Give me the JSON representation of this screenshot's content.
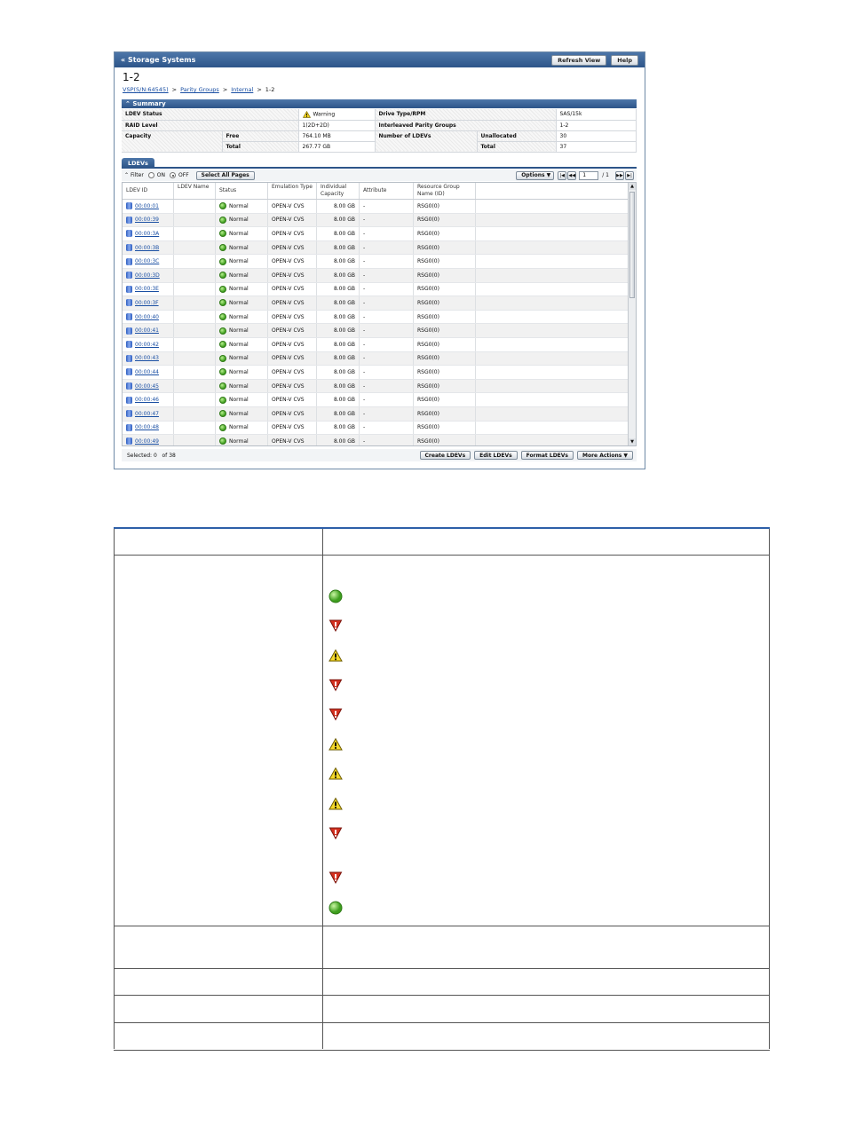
{
  "window": {
    "title": "Storage Systems",
    "refresh_label": "Refresh View",
    "help_label": "Help"
  },
  "page_title": "1-2",
  "breadcrumb": {
    "items": [
      "VSP(S/N:64545)",
      "Parity Groups",
      "Internal"
    ],
    "current": "1-2",
    "separator": ">"
  },
  "summary": {
    "header": "Summary",
    "ldev_status_label": "LDEV Status",
    "ldev_status_value": "Warning",
    "raid_level_label": "RAID Level",
    "raid_level_value": "1(2D+2D)",
    "capacity_label": "Capacity",
    "free_label": "Free",
    "free_value": "764.10 MB",
    "total_label": "Total",
    "total_value": "267.77 GB",
    "drive_type_label": "Drive Type/RPM",
    "drive_type_value": "SAS/15k",
    "interleaved_label": "Interleaved Parity Groups",
    "interleaved_value": "1-2",
    "num_ldevs_label": "Number of LDEVs",
    "unallocated_label": "Unallocated",
    "unallocated_value": "30",
    "ldev_total_label": "Total",
    "ldev_total_value": "37"
  },
  "tab": {
    "label": "LDEVs"
  },
  "toolbar": {
    "filter_label": "Filter",
    "on_label": "ON",
    "off_label": "OFF",
    "select_all_label": "Select All Pages",
    "options_label": "Options",
    "page_value": "1",
    "page_total": "/ 1"
  },
  "columns": [
    "LDEV ID",
    "LDEV Name",
    "Status",
    "Emulation Type",
    "Individual Capacity",
    "Attribute",
    "Resource Group Name (ID)"
  ],
  "rows": [
    {
      "id": "00:00:01",
      "name": "",
      "status": "Normal",
      "emulation": "OPEN-V CVS",
      "capacity": "8.00 GB",
      "attribute": "-",
      "rg": "RSG0(0)"
    },
    {
      "id": "00:00:39",
      "name": "",
      "status": "Normal",
      "emulation": "OPEN-V CVS",
      "capacity": "8.00 GB",
      "attribute": "-",
      "rg": "RSG0(0)"
    },
    {
      "id": "00:00:3A",
      "name": "",
      "status": "Normal",
      "emulation": "OPEN-V CVS",
      "capacity": "8.00 GB",
      "attribute": "-",
      "rg": "RSG0(0)"
    },
    {
      "id": "00:00:3B",
      "name": "",
      "status": "Normal",
      "emulation": "OPEN-V CVS",
      "capacity": "8.00 GB",
      "attribute": "-",
      "rg": "RSG0(0)"
    },
    {
      "id": "00:00:3C",
      "name": "",
      "status": "Normal",
      "emulation": "OPEN-V CVS",
      "capacity": "8.00 GB",
      "attribute": "-",
      "rg": "RSG0(0)"
    },
    {
      "id": "00:00:3D",
      "name": "",
      "status": "Normal",
      "emulation": "OPEN-V CVS",
      "capacity": "8.00 GB",
      "attribute": "-",
      "rg": "RSG0(0)"
    },
    {
      "id": "00:00:3E",
      "name": "",
      "status": "Normal",
      "emulation": "OPEN-V CVS",
      "capacity": "8.00 GB",
      "attribute": "-",
      "rg": "RSG0(0)"
    },
    {
      "id": "00:00:3F",
      "name": "",
      "status": "Normal",
      "emulation": "OPEN-V CVS",
      "capacity": "8.00 GB",
      "attribute": "-",
      "rg": "RSG0(0)"
    },
    {
      "id": "00:00:40",
      "name": "",
      "status": "Normal",
      "emulation": "OPEN-V CVS",
      "capacity": "8.00 GB",
      "attribute": "-",
      "rg": "RSG0(0)"
    },
    {
      "id": "00:00:41",
      "name": "",
      "status": "Normal",
      "emulation": "OPEN-V CVS",
      "capacity": "8.00 GB",
      "attribute": "-",
      "rg": "RSG0(0)"
    },
    {
      "id": "00:00:42",
      "name": "",
      "status": "Normal",
      "emulation": "OPEN-V CVS",
      "capacity": "8.00 GB",
      "attribute": "-",
      "rg": "RSG0(0)"
    },
    {
      "id": "00:00:43",
      "name": "",
      "status": "Normal",
      "emulation": "OPEN-V CVS",
      "capacity": "8.00 GB",
      "attribute": "-",
      "rg": "RSG0(0)"
    },
    {
      "id": "00:00:44",
      "name": "",
      "status": "Normal",
      "emulation": "OPEN-V CVS",
      "capacity": "8.00 GB",
      "attribute": "-",
      "rg": "RSG0(0)"
    },
    {
      "id": "00:00:45",
      "name": "",
      "status": "Normal",
      "emulation": "OPEN-V CVS",
      "capacity": "8.00 GB",
      "attribute": "-",
      "rg": "RSG0(0)"
    },
    {
      "id": "00:00:46",
      "name": "",
      "status": "Normal",
      "emulation": "OPEN-V CVS",
      "capacity": "8.00 GB",
      "attribute": "-",
      "rg": "RSG0(0)"
    },
    {
      "id": "00:00:47",
      "name": "",
      "status": "Normal",
      "emulation": "OPEN-V CVS",
      "capacity": "8.00 GB",
      "attribute": "-",
      "rg": "RSG0(0)"
    },
    {
      "id": "00:00:48",
      "name": "",
      "status": "Normal",
      "emulation": "OPEN-V CVS",
      "capacity": "8.00 GB",
      "attribute": "-",
      "rg": "RSG0(0)"
    },
    {
      "id": "00:00:49",
      "name": "",
      "status": "Normal",
      "emulation": "OPEN-V CVS",
      "capacity": "8.00 GB",
      "attribute": "-",
      "rg": "RSG0(0)"
    }
  ],
  "footer": {
    "selected_label": "Selected:",
    "selected_count": "0",
    "of_label": "of",
    "total_count": "38",
    "create_label": "Create LDEVs",
    "edit_label": "Edit LDEVs",
    "format_label": "Format LDEVs",
    "more_label": "More Actions"
  },
  "status_icons": [
    "normal-icon",
    "error-icon",
    "warning-icon",
    "error-icon",
    "error-icon",
    "warning-icon",
    "warning-icon",
    "warning-icon",
    "error-icon",
    "error-icon",
    "normal-icon"
  ],
  "colors": {
    "header_blue": "#2d5589",
    "link": "#1a4fa3",
    "normal_green": "#3e9e1e",
    "error_red": "#c8281e",
    "warning_yellow": "#f2d21e"
  }
}
